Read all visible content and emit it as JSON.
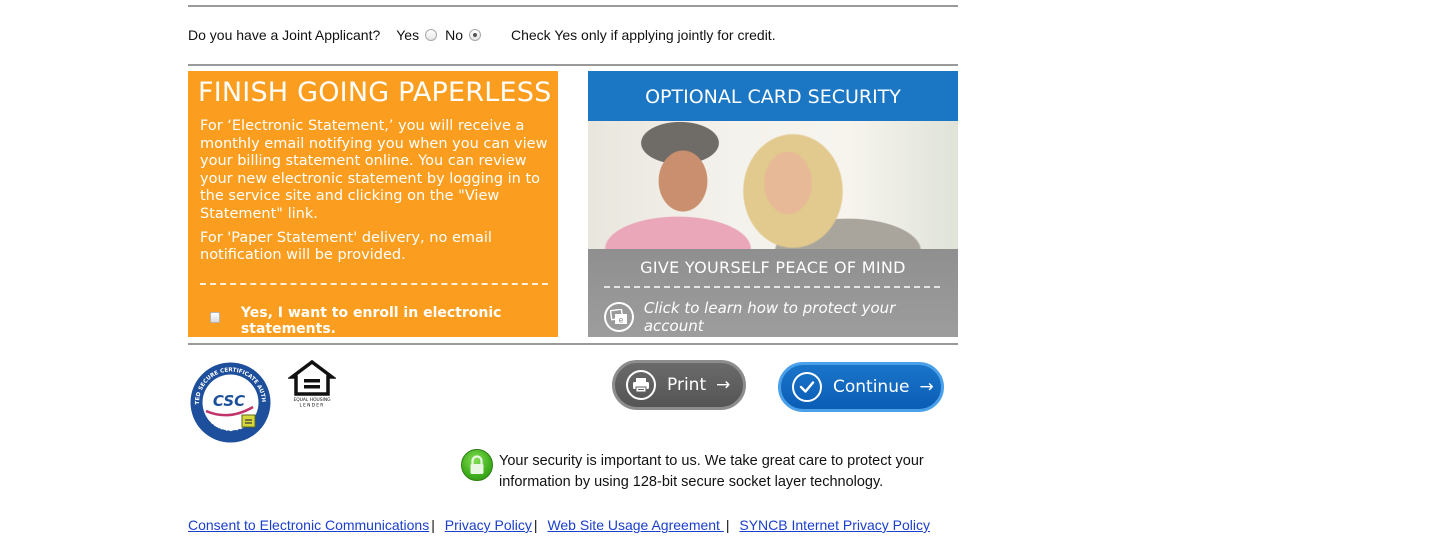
{
  "joint_applicant": {
    "question": "Do you have a Joint Applicant?",
    "options": [
      {
        "label": "Yes",
        "checked": false
      },
      {
        "label": "No",
        "checked": true
      }
    ],
    "hint": "Check Yes only if applying jointly for credit."
  },
  "paperless": {
    "title": "FINISH GOING PAPERLESS",
    "paragraphs": [
      "For ‘Electronic Statement,’ you will receive a monthly email notifying you when you can view your billing statement online. You can review your new electronic statement by logging in to the service site and clicking on the \"View Statement\" link.",
      "For 'Paper Statement' delivery, no email notification will be provided."
    ],
    "enroll_label": "Yes, I want to enroll in electronic statements.",
    "enroll_checked": false,
    "background_color": "#fb9e1f"
  },
  "card_security": {
    "title": "OPTIONAL CARD SECURITY",
    "tagline": "GIVE YOURSELF PEACE OF MIND",
    "link_text": "Click to learn how to protect your account",
    "header_color": "#1b77c4"
  },
  "logos": {
    "csc": {
      "top_text": "TRUSTED SECURE CERTIFICATE AUTHORITY",
      "center": "CSC",
      "bottom_text": "POINT TO VERIFY"
    },
    "equal_housing": {
      "line1": "EQUAL HOUSING",
      "line2": "LENDER"
    }
  },
  "buttons": {
    "print": {
      "label": "Print",
      "icon": "printer-icon",
      "arrow": "→"
    },
    "continue": {
      "label": "Continue",
      "icon": "check-circle-icon",
      "arrow": "→"
    }
  },
  "security_note": "Your security is important to us. We take great care to protect your information by using 128-bit secure socket layer technology.",
  "footer_links": [
    {
      "label": "Consent to Electronic Communications"
    },
    {
      "label": "Privacy Policy"
    },
    {
      "label": "Web Site Usage Agreement "
    },
    {
      "label": "SYNCB Internet Privacy Policy"
    }
  ],
  "footer_separator": "|"
}
